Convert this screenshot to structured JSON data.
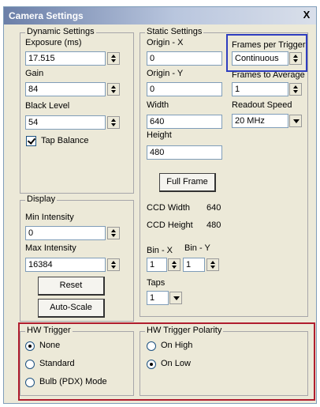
{
  "window": {
    "title": "Camera Settings",
    "close_label": "X"
  },
  "dynamic": {
    "group_label": "Dynamic Settings",
    "exposure_label": "Exposure (ms)",
    "exposure_value": "17.515",
    "gain_label": "Gain",
    "gain_value": "84",
    "black_level_label": "Black Level",
    "black_level_value": "54",
    "tap_balance_label": "Tap Balance",
    "tap_balance_checked": true
  },
  "static": {
    "group_label": "Static Settings",
    "origin_x_label": "Origin - X",
    "origin_x_value": "0",
    "origin_y_label": "Origin - Y",
    "origin_y_value": "0",
    "width_label": "Width",
    "width_value": "640",
    "height_label": "Height",
    "height_value": "480",
    "fpt_label": "Frames per Trigger",
    "fpt_value": "Continuous",
    "fta_label": "Frames to Average",
    "fta_value": "1",
    "readout_label": "Readout Speed",
    "readout_value": "20 MHz",
    "full_frame_label": "Full Frame",
    "ccd_width_label": "CCD Width",
    "ccd_width_value": "640",
    "ccd_height_label": "CCD Height",
    "ccd_height_value": "480",
    "bin_x_label": "Bin - X",
    "bin_x_value": "1",
    "bin_y_label": "Bin - Y",
    "bin_y_value": "1",
    "taps_label": "Taps",
    "taps_value": "1"
  },
  "display": {
    "group_label": "Display",
    "min_label": "Min Intensity",
    "min_value": "0",
    "max_label": "Max Intensity",
    "max_value": "16384",
    "reset_label": "Reset",
    "autoscale_label": "Auto-Scale"
  },
  "hw_trigger": {
    "group_label": "HW Trigger",
    "options": [
      "None",
      "Standard",
      "Bulb (PDX) Mode"
    ],
    "selected": "None"
  },
  "hw_polarity": {
    "group_label": "HW Trigger Polarity",
    "options": [
      "On High",
      "On Low"
    ],
    "selected": "On Low"
  },
  "colors": {
    "highlight_blue": "#2e3dbf",
    "highlight_red": "#b01d2e",
    "title_bar": "#6b7fa8"
  }
}
